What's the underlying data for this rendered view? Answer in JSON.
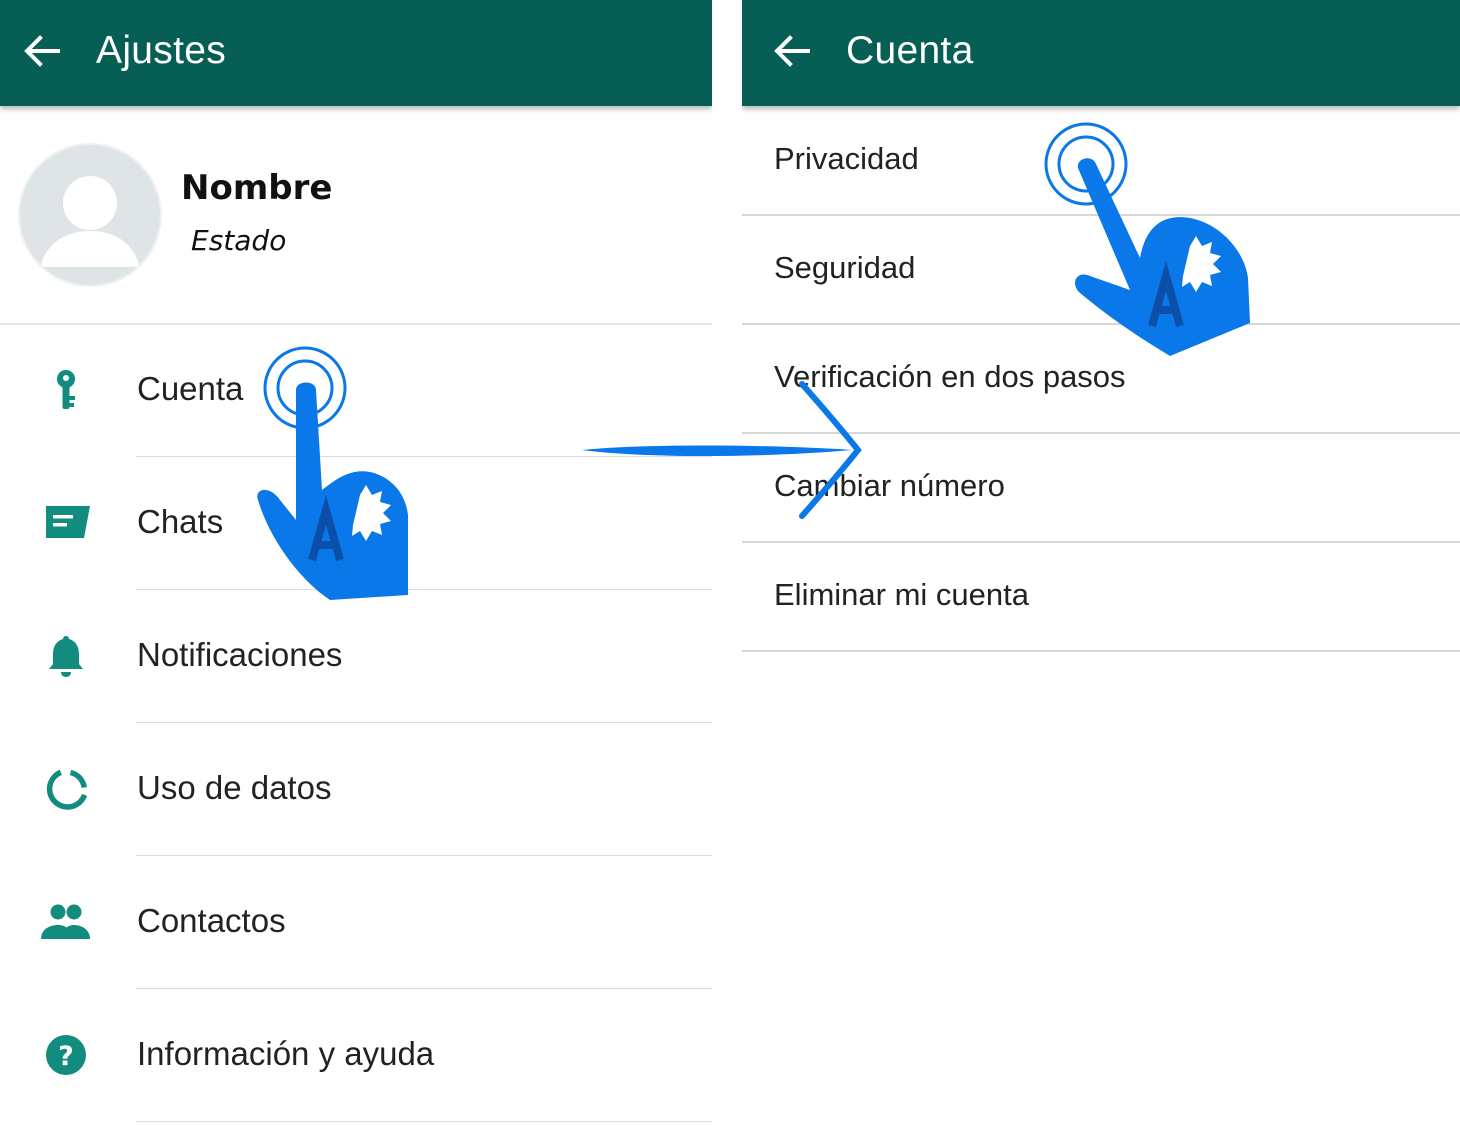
{
  "left": {
    "title": "Ajustes",
    "profile": {
      "name": "Nombre",
      "status": "Estado"
    },
    "items": [
      {
        "label": "Cuenta",
        "icon": "key-icon"
      },
      {
        "label": "Chats",
        "icon": "chat-icon"
      },
      {
        "label": "Notificaciones",
        "icon": "bell-icon"
      },
      {
        "label": "Uso de datos",
        "icon": "data-usage-icon"
      },
      {
        "label": "Contactos",
        "icon": "contacts-icon"
      },
      {
        "label": "Información y ayuda",
        "icon": "help-icon"
      }
    ]
  },
  "right": {
    "title": "Cuenta",
    "items": [
      {
        "label": "Privacidad"
      },
      {
        "label": "Seguridad"
      },
      {
        "label": "Verificación en dos pasos"
      },
      {
        "label": "Cambiar número"
      },
      {
        "label": "Eliminar mi cuenta"
      }
    ]
  },
  "colors": {
    "toolbar": "#075e54",
    "icon_accent": "#128c7e",
    "overlay_blue": "#0a78e8",
    "divider": "#dcdcdc"
  }
}
